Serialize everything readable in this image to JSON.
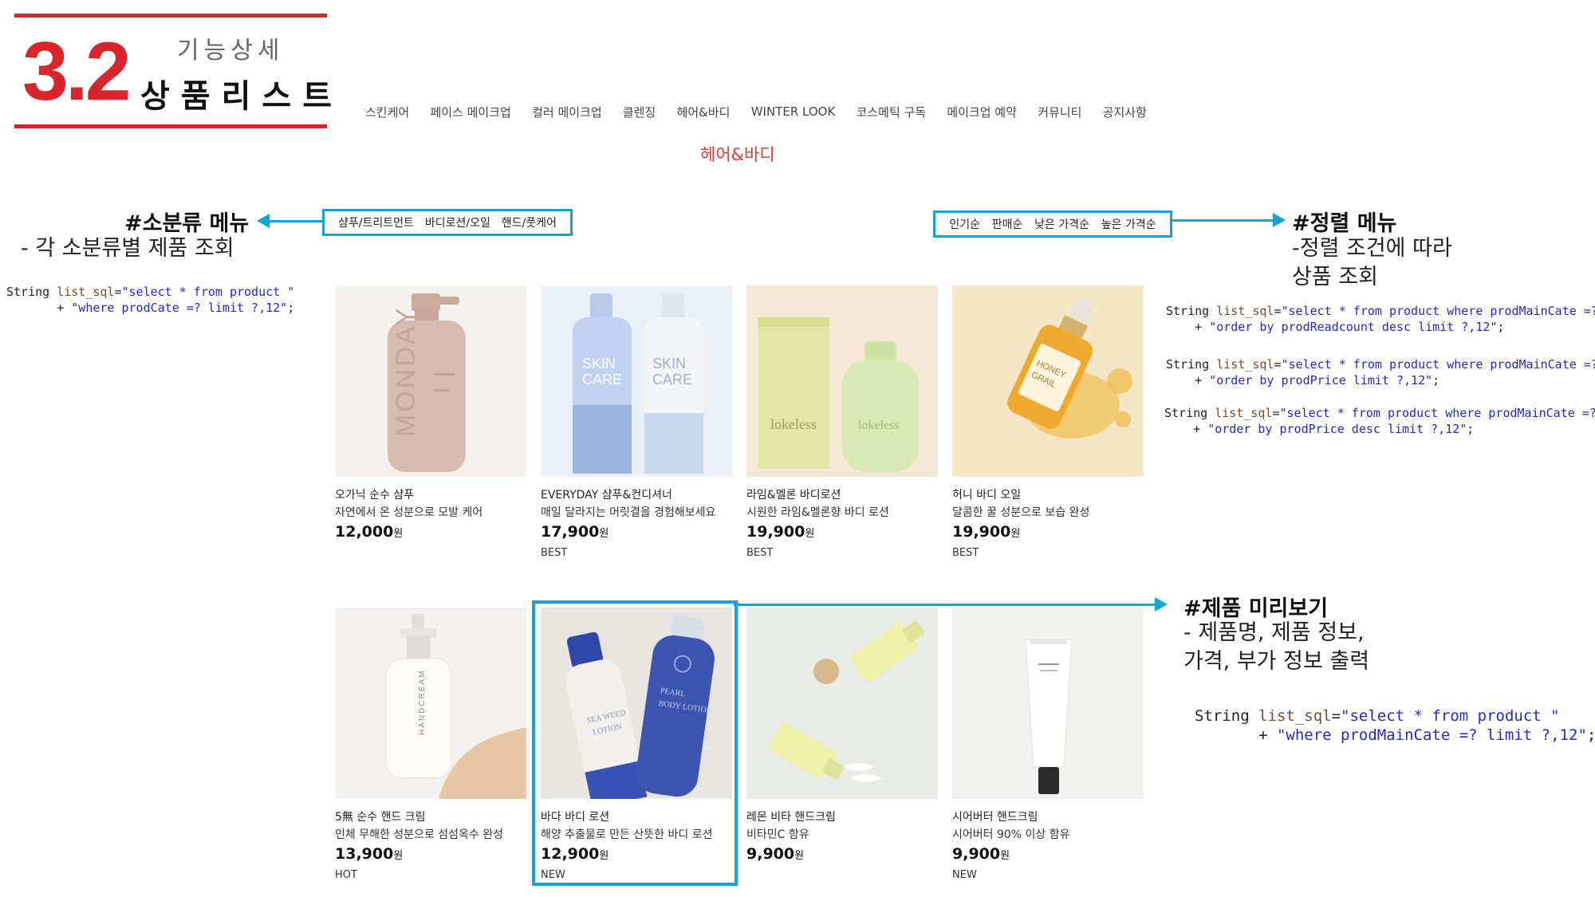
{
  "header": {
    "section_number": "3.2",
    "kicker": "기능상세",
    "title": "상품리스트",
    "accent_color": "#d9262c"
  },
  "nav": {
    "items": [
      "스킨케어",
      "페이스 메이크업",
      "컬러 메이크업",
      "클렌징",
      "헤어&바디",
      "WINTER LOOK",
      "코스메틱 구독",
      "메이크업 예약",
      "커뮤니티",
      "공지사항"
    ]
  },
  "category_title": "헤어&바디",
  "subcategory_menu": {
    "items": [
      "샴푸/트리트먼트",
      "바디로션/오일",
      "핸드/풋케어"
    ],
    "annotation_title": "#소분류 메뉴",
    "annotation_desc": "- 각 소분류별 제품 조회",
    "code": {
      "l1_a": "String ",
      "l1_b": "list_sql",
      "l1_c": "=",
      "l1_d": "\"select * from product \"",
      "l2_a": "       + ",
      "l2_b": "\"where prodCate =? limit ?,12\"",
      "l2_c": ";"
    }
  },
  "sort_menu": {
    "items": [
      "인기순",
      "판매순",
      "낮은 가격순",
      "높은 가격순"
    ],
    "annotation_title": "#정렬 메뉴",
    "annotation_desc_1": "-정렬 조건에 따라",
    "annotation_desc_2": "상품 조회",
    "code": [
      {
        "a": "String ",
        "b": "list_sql",
        "c": "=",
        "d": "\"select * from product where prodMainCate =? \"",
        "e": "    + ",
        "f": "\"order by prodReadcount desc limit ?,12\"",
        "g": ";"
      },
      {
        "a": "String ",
        "b": "list_sql",
        "c": "=",
        "d": "\"select * from product where prodMainCate =? \"",
        "e": "    + ",
        "f": "\"order by prodPrice limit ?,12\"",
        "g": ";"
      },
      {
        "a": "String ",
        "b": "list_sql",
        "c": "=",
        "d": "\"select * from product where prodMainCate =? \"",
        "e": "    + ",
        "f": "\"order by prodPrice desc limit ?,12\"",
        "g": ";"
      }
    ]
  },
  "preview": {
    "annotation_title": "#제품 미리보기",
    "annotation_desc_1": "- 제품명, 제품 정보,",
    "annotation_desc_2": "가격, 부가 정보 출력",
    "code": {
      "l1_a": "String ",
      "l1_b": "list_sql",
      "l1_c": "=",
      "l1_d": "\"select * from product \"",
      "l2_a": "       + ",
      "l2_b": "\"where prodMainCate =? limit ?,12\"",
      "l2_c": ";"
    }
  },
  "products": [
    {
      "name": "오가닉 순수 샴푸",
      "desc": "자연에서 온 성분으로 모발 케어",
      "price": "12,000",
      "unit": "원",
      "badge": "",
      "image": "pink-pump-bottle"
    },
    {
      "name": "EVERYDAY 샴푸&컨디셔너",
      "desc": "매일 달라지는 머릿결을 경험해보세요",
      "price": "17,900",
      "unit": "원",
      "badge": "BEST",
      "image": "blue-white-bottles"
    },
    {
      "name": "라임&멜론 바디로션",
      "desc": "시원한 라임&멜론향 바디 로션",
      "price": "19,900",
      "unit": "원",
      "badge": "BEST",
      "image": "green-bottle-box"
    },
    {
      "name": "허니 바디 오일",
      "desc": "달콤한 꿀 성분으로 보습 완성",
      "price": "19,900",
      "unit": "원",
      "badge": "BEST",
      "image": "honey-dropper-bottle"
    },
    {
      "name": "5無 순수 핸드 크림",
      "desc": "인체 무해한 성분으로 섬섬옥수 완성",
      "price": "13,900",
      "unit": "원",
      "badge": "HOT",
      "image": "white-pump-bottle"
    },
    {
      "name": "바다 바디 로션",
      "desc": "해양 추출물로 만든 산뜻한 바디 로션",
      "price": "12,900",
      "unit": "원",
      "badge": "NEW",
      "image": "navy-lotion-bottles"
    },
    {
      "name": "레몬 비타 핸드크림",
      "desc": "비타민C 함유",
      "price": "9,900",
      "unit": "원",
      "badge": "",
      "image": "yellow-tubes"
    },
    {
      "name": "시어버터 핸드크림",
      "desc": "시어버터 90% 이상 함유",
      "price": "9,900",
      "unit": "원",
      "badge": "NEW",
      "image": "white-tube"
    }
  ],
  "colors": {
    "highlight": "#13a4e0",
    "category": "#e03a3a"
  }
}
